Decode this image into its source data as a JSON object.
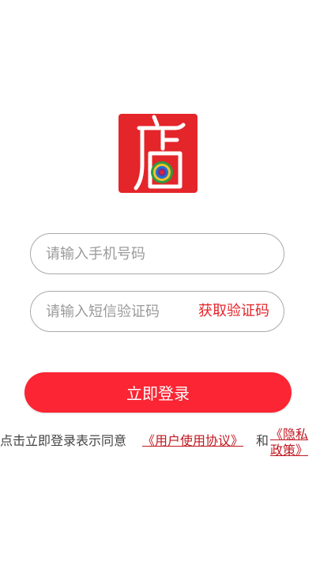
{
  "logo": {
    "icon": "store-logo-icon",
    "brand_color": "#e4252a"
  },
  "phone_field": {
    "placeholder": "请输入手机号码",
    "value": ""
  },
  "code_field": {
    "placeholder": "请输入短信验证码",
    "value": "",
    "get_code_label": "获取验证码"
  },
  "login": {
    "button_label": "立即登录",
    "button_color": "#fb2533"
  },
  "agreement": {
    "prefix": "点击立即登录表示同意",
    "user_agreement": "《用户使用协议》",
    "and": "和",
    "privacy_policy": "《隐私政策》"
  }
}
